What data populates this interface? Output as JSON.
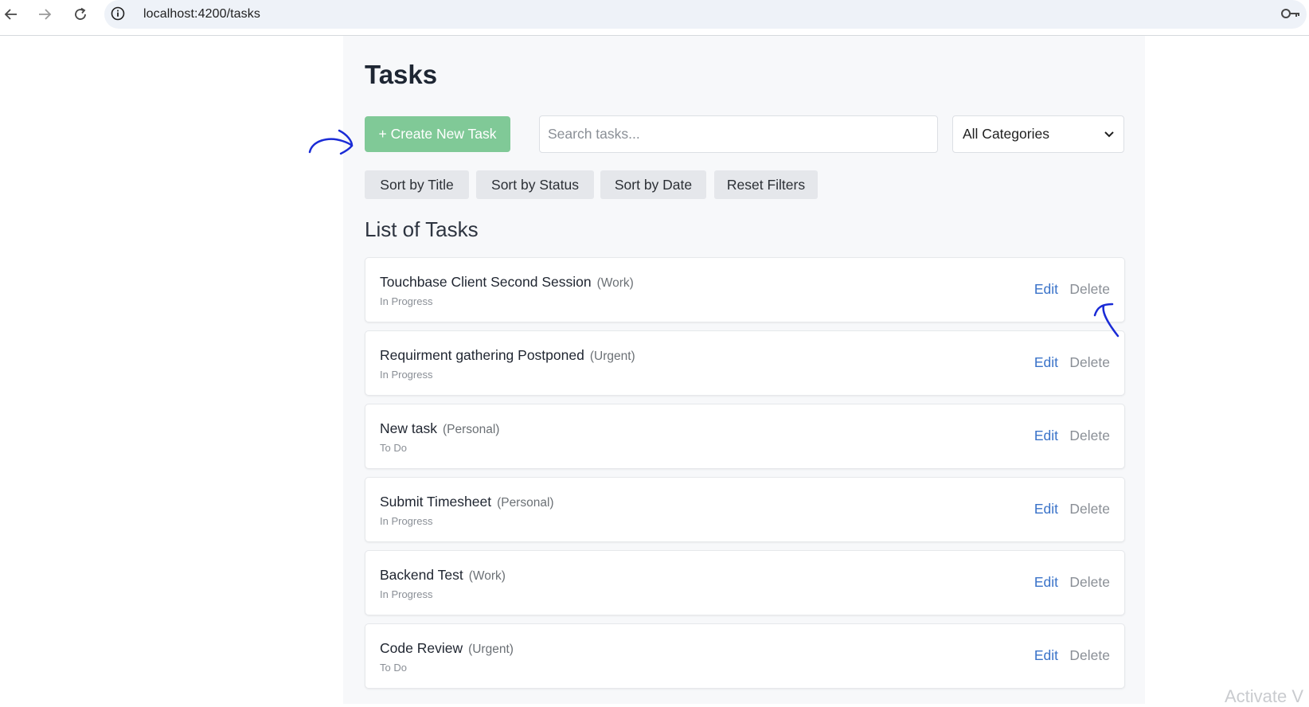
{
  "browser": {
    "url": "localhost:4200/tasks",
    "back_icon": "arrow-left-icon",
    "forward_icon": "arrow-right-icon",
    "reload_icon": "reload-icon",
    "info_icon": "info-icon",
    "key_icon": "key-icon"
  },
  "page": {
    "title": "Tasks",
    "create_button": "+ Create New Task",
    "search_placeholder": "Search tasks...",
    "category_select": "All Categories",
    "sort_buttons": [
      "Sort by Title",
      "Sort by Status",
      "Sort by Date",
      "Reset Filters"
    ],
    "list_title": "List of Tasks"
  },
  "tasks": [
    {
      "title": "Touchbase Client Second Session",
      "category": "(Work)",
      "status": "In Progress",
      "edit": "Edit",
      "delete": "Delete"
    },
    {
      "title": "Requirment gathering Postponed",
      "category": "(Urgent)",
      "status": "In Progress",
      "edit": "Edit",
      "delete": "Delete"
    },
    {
      "title": "New task",
      "category": "(Personal)",
      "status": "To Do",
      "edit": "Edit",
      "delete": "Delete"
    },
    {
      "title": "Submit Timesheet",
      "category": "(Personal)",
      "status": "In Progress",
      "edit": "Edit",
      "delete": "Delete"
    },
    {
      "title": "Backend Test",
      "category": "(Work)",
      "status": "In Progress",
      "edit": "Edit",
      "delete": "Delete"
    },
    {
      "title": "Code Review",
      "category": "(Urgent)",
      "status": "To Do",
      "edit": "Edit",
      "delete": "Delete"
    }
  ],
  "overlay": {
    "watermark": "Activate V"
  },
  "colors": {
    "create_button_bg": "#80c997",
    "edit_link": "#3a73c9",
    "annotation": "#1a2bd6"
  }
}
